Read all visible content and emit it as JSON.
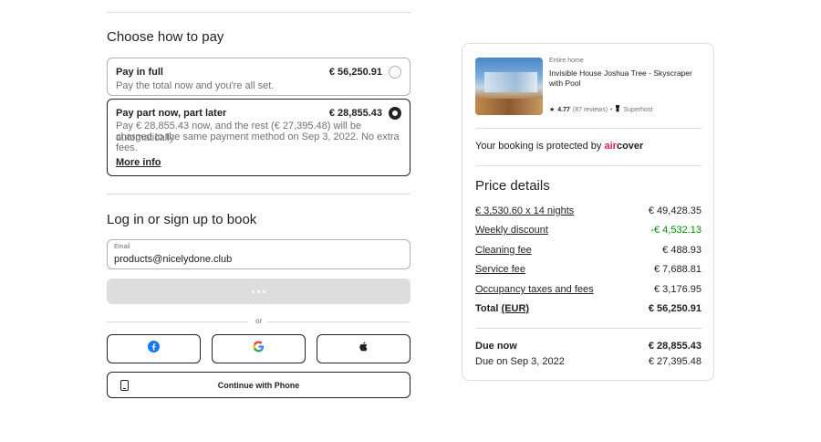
{
  "choose": {
    "title": "Choose how to pay",
    "options": [
      {
        "label": "Pay in full",
        "amount": "€ 56,250.91",
        "description": "Pay the total now and you're all set.",
        "selected": false
      },
      {
        "label": "Pay part now, part later",
        "amount": "€ 28,855.43",
        "description_lines": [
          "Pay € 28,855.43 now, and the rest (€ 27,395.48) will be automatically",
          "charged to the same payment method on Sep 3, 2022. No extra",
          "fees."
        ],
        "more_info": "More info",
        "selected": true
      }
    ]
  },
  "login": {
    "title": "Log in or sign up to book",
    "email_label": "Email",
    "email_value": "products@nicelydone.club",
    "or": "or",
    "phone_button": "Continue with Phone",
    "social": [
      "facebook-icon",
      "google-icon",
      "apple-icon"
    ]
  },
  "listing": {
    "type": "Entire home",
    "title": "Invisible House Joshua Tree - Skyscraper with Pool",
    "rating": "4.77",
    "reviews": "(87 reviews)",
    "separator": "•",
    "badge": "Superhost",
    "protected_text": "Your booking is protected by",
    "aircover_air": "air",
    "aircover_cover": "cover"
  },
  "price": {
    "title": "Price details",
    "rows": [
      {
        "label": "€ 3,530.60 x 14 nights",
        "value": "€ 49,428.35"
      },
      {
        "label": "Weekly discount",
        "value": "-€ 4,532.13"
      },
      {
        "label": "Cleaning fee",
        "value": "€ 488.93"
      },
      {
        "label": "Service fee",
        "value": "€ 7,688.81"
      },
      {
        "label": "Occupancy taxes and fees",
        "value": "€ 3,176.95"
      }
    ],
    "total_label": "Total",
    "total_unit": "(EUR)",
    "total_value": "€ 56,250.91",
    "due_now_label": "Due now",
    "due_now_value": "€ 28,855.43",
    "due_later_label": "Due on Sep 3, 2022",
    "due_later_value": "€ 27,395.48"
  },
  "colors": {
    "brand": "#e61e4d",
    "discount": "#008a05",
    "text": "#222222",
    "muted": "#717171",
    "border": "#dddddd"
  }
}
